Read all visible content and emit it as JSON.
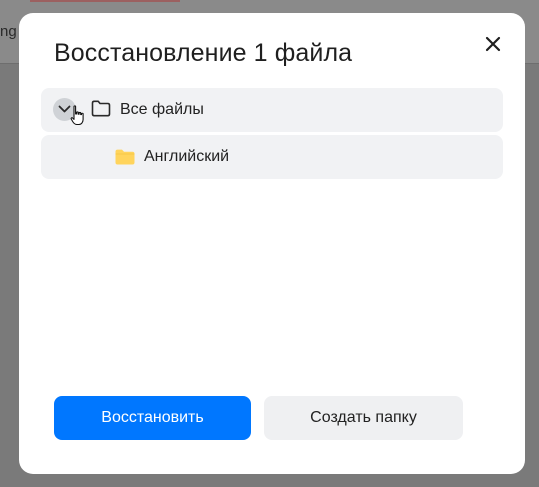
{
  "background": {
    "partial_text": "ng"
  },
  "dialog": {
    "title": "Восстановление 1 файла",
    "close_icon": "close-icon",
    "tree": {
      "root": {
        "label": "Все файлы",
        "expanded": true,
        "icon": "folder-outline-icon"
      },
      "children": [
        {
          "label": "Английский",
          "icon": "folder-filled-icon"
        }
      ]
    },
    "buttons": {
      "restore": "Восстановить",
      "create_folder": "Создать папку"
    }
  },
  "colors": {
    "primary": "#0077ff",
    "folder_yellow": "#ffd45c",
    "row_bg": "#f1f2f4",
    "overlay": "#7a7a7a"
  }
}
